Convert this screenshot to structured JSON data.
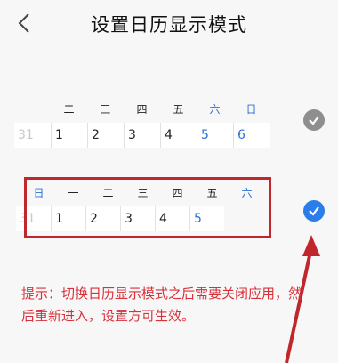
{
  "header": {
    "title": "设置日历显示模式"
  },
  "option_monday_first": {
    "weekdays": [
      "一",
      "二",
      "三",
      "四",
      "五",
      "六",
      "日"
    ],
    "weekdays_blue": [
      false,
      false,
      false,
      false,
      false,
      true,
      true
    ],
    "days": [
      "31",
      "1",
      "2",
      "3",
      "4",
      "5",
      "6"
    ],
    "days_muted": [
      true,
      false,
      false,
      false,
      false,
      false,
      false
    ],
    "days_blue": [
      false,
      false,
      false,
      false,
      false,
      true,
      true
    ],
    "selected": false
  },
  "option_sunday_first": {
    "weekdays": [
      "日",
      "一",
      "二",
      "三",
      "四",
      "五",
      "六"
    ],
    "weekdays_blue": [
      true,
      false,
      false,
      false,
      false,
      false,
      true
    ],
    "days": [
      "31",
      "1",
      "2",
      "3",
      "4",
      "5"
    ],
    "days_muted": [
      true,
      false,
      false,
      false,
      false,
      false
    ],
    "days_blue": [
      false,
      false,
      false,
      false,
      false,
      true
    ],
    "selected": true
  },
  "hint": {
    "text": "提示：切换日历显示模式之后需要关闭应用，然后重新进入，设置方可生效。"
  },
  "colors": {
    "accent": "#2b7de9",
    "annotation": "#c0272d",
    "hint": "#d8313a"
  },
  "icons": {
    "back": "chevron-left-icon",
    "selected": "checkmark-icon"
  }
}
